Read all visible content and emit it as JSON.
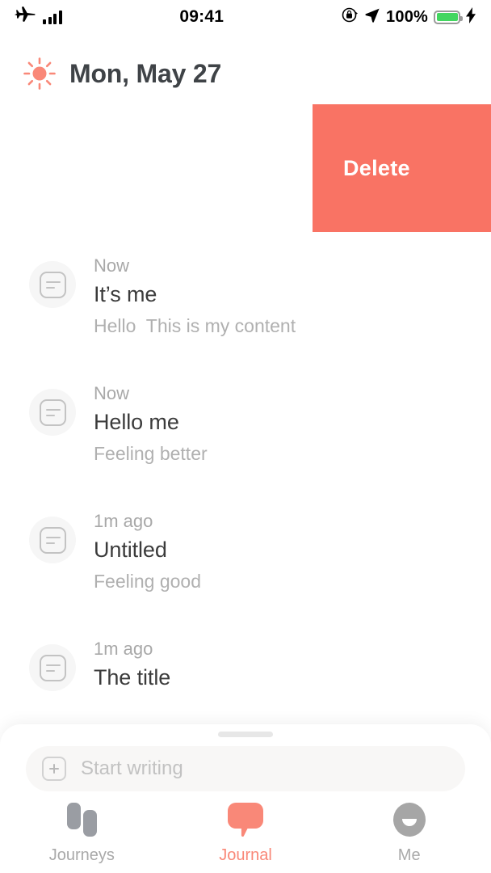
{
  "status_bar": {
    "airplane_icon": "airplane-icon",
    "signal_icon": "signal-bars-icon",
    "time": "09:41",
    "rotation_lock_icon": "rotation-lock-icon",
    "location_icon": "location-arrow-icon",
    "battery_percent": "100%",
    "battery_icon": "battery-icon",
    "charging_icon": "lightning-bolt-icon",
    "battery_color": "#43d660"
  },
  "header": {
    "weather_icon": "sun-icon",
    "weather_icon_color": "#f98878",
    "date": "Mon, May 27"
  },
  "swipe_action": {
    "label": "Delete",
    "color": "#f97364"
  },
  "entries": [
    {
      "time": "Now",
      "title": "It’s me",
      "snippet": "Hello  This is my content",
      "icon": "note-icon"
    },
    {
      "time": "Now",
      "title": "Hello me",
      "snippet": "Feeling better",
      "icon": "note-icon"
    },
    {
      "time": "1m ago",
      "title": "Untitled",
      "snippet": "Feeling good",
      "icon": "note-icon"
    },
    {
      "time": "1m ago",
      "title": "The title",
      "snippet": "",
      "icon": "note-icon"
    }
  ],
  "sheet": {
    "drag_handle": "drag-handle",
    "compose": {
      "add_icon": "plus-icon",
      "placeholder": "Start writing",
      "value": ""
    }
  },
  "tabbar": {
    "active": "Journal",
    "accent_color": "#f98878",
    "inactive_color": "#a9a9a9",
    "tabs": [
      {
        "label": "Journeys",
        "icon": "journeys-icon"
      },
      {
        "label": "Journal",
        "icon": "journal-bubble-icon"
      },
      {
        "label": "Me",
        "icon": "profile-smile-icon"
      }
    ]
  }
}
